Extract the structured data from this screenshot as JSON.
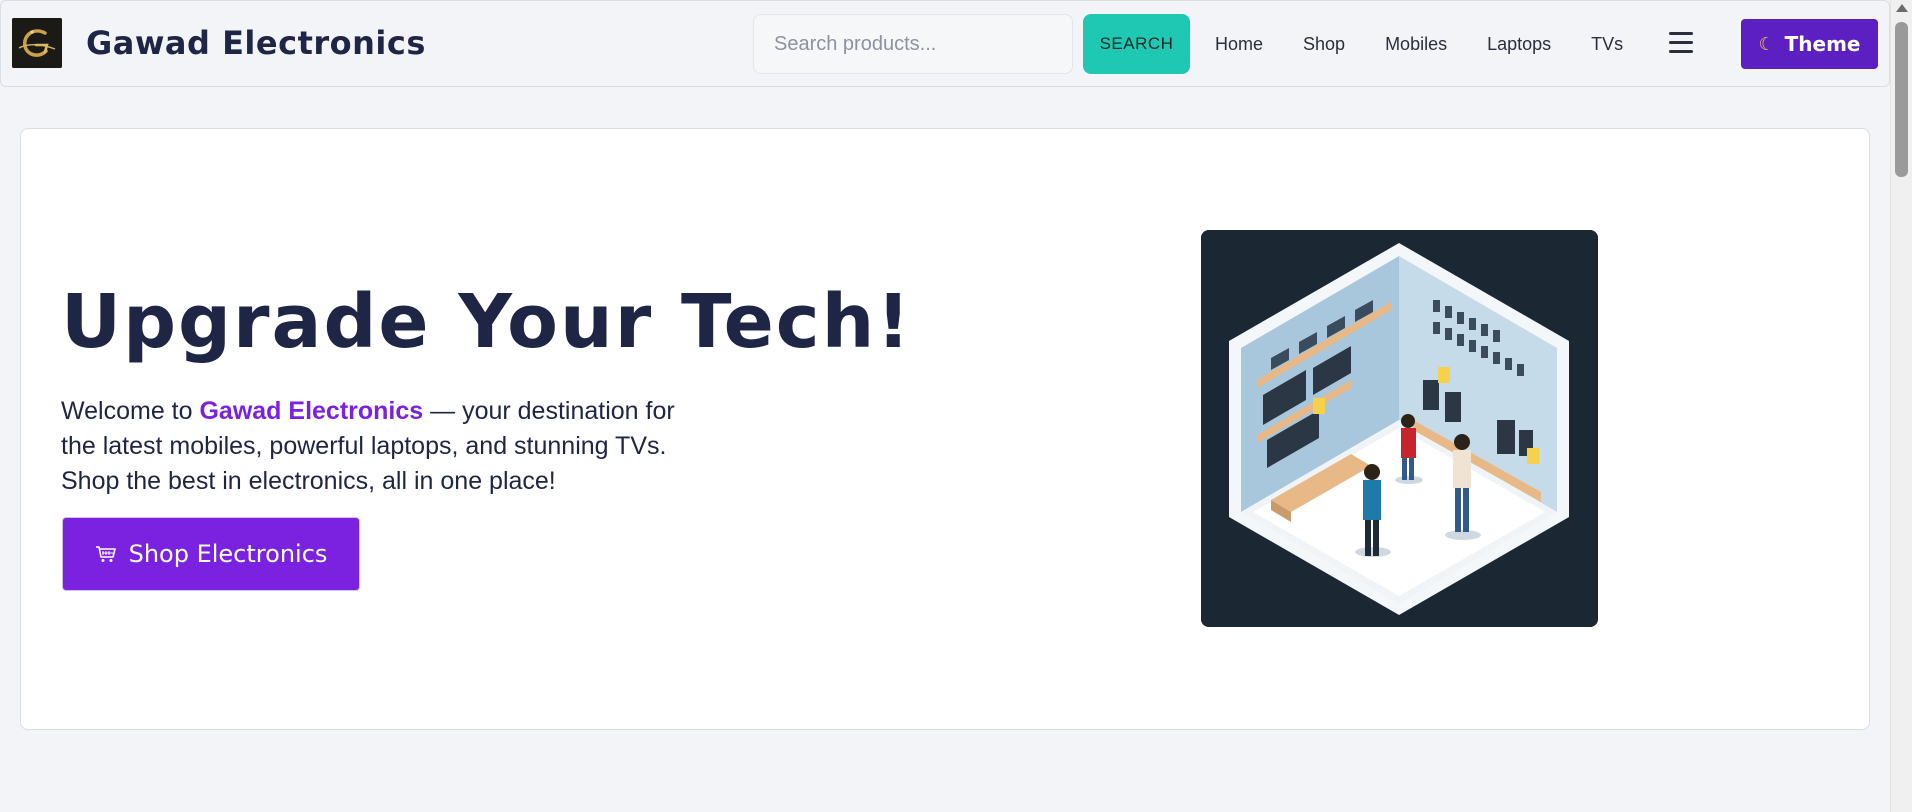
{
  "header": {
    "brand": "Gawad Electronics",
    "search_placeholder": "Search products...",
    "search_button": "SEARCH",
    "nav": [
      "Home",
      "Shop",
      "Mobiles",
      "Laptops",
      "TVs"
    ],
    "theme_button": "Theme",
    "icons": {
      "logo": "gold-letter-g-logo",
      "menu": "hamburger-menu-icon",
      "theme": "moon-icon"
    }
  },
  "hero": {
    "title": "Upgrade Your Tech!",
    "text_prefix": "Welcome to ",
    "text_highlight": "Gawad Electronics",
    "text_suffix": " — your destination for the latest mobiles, powerful laptops, and stunning TVs. Shop the best in electronics, all in one place!",
    "cta": "Shop Electronics",
    "cta_icon": "shopping-cart-icon",
    "image": "isometric-electronics-store-illustration"
  },
  "colors": {
    "accent": "#7a22e0",
    "theme_button": "#5b1fc2",
    "search_button": "#1fc8b3",
    "heading": "#1e2545",
    "page_bg": "#f3f4f8",
    "image_bg": "#1b2733"
  }
}
